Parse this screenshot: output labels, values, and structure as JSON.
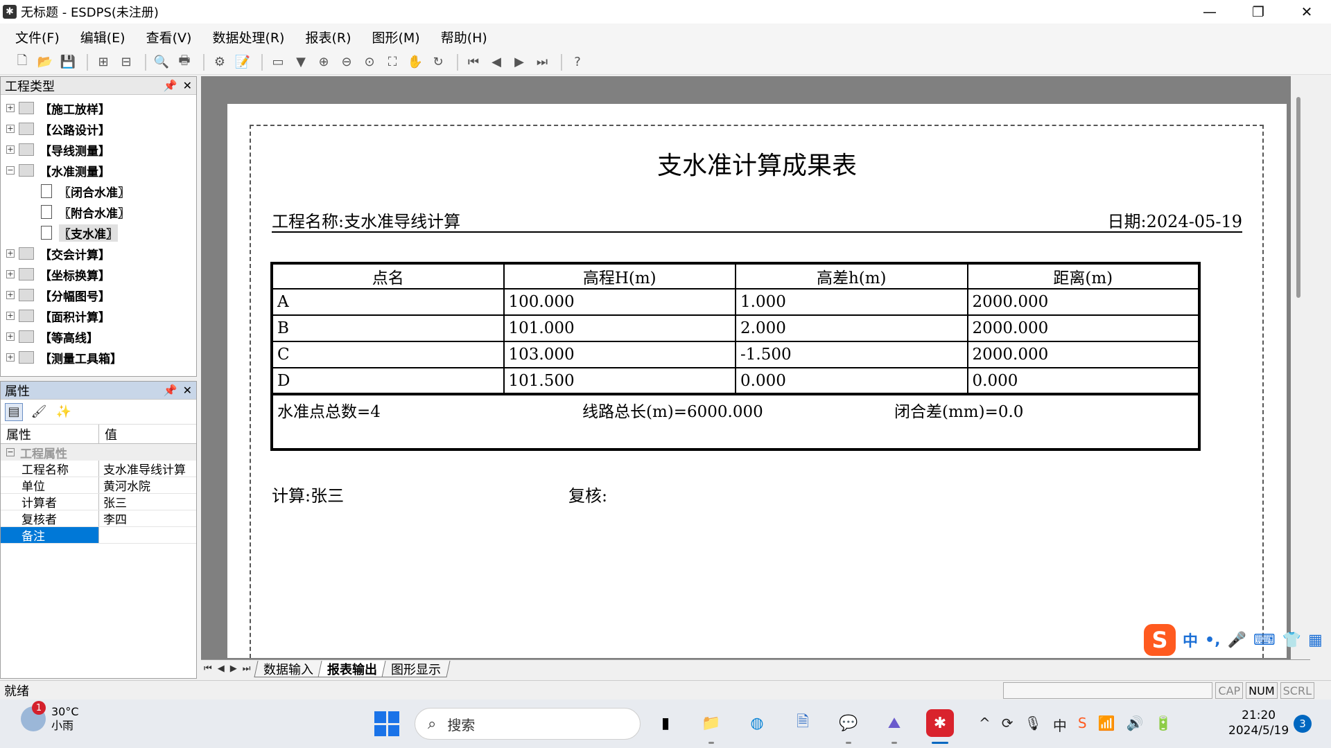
{
  "window": {
    "title": "无标题 - ESDPS(未注册)",
    "app_icon": "star-icon",
    "controls": [
      "minimize-icon",
      "restore-icon",
      "close-icon"
    ]
  },
  "menu": [
    {
      "label": "文件(F)"
    },
    {
      "label": "编辑(E)"
    },
    {
      "label": "查看(V)"
    },
    {
      "label": "数据处理(R)"
    },
    {
      "label": "报表(R)"
    },
    {
      "label": "图形(M)"
    },
    {
      "label": "帮助(H)"
    }
  ],
  "project_panel": {
    "title": "工程类型",
    "tree": [
      {
        "label": "【施工放样】",
        "expanded": false
      },
      {
        "label": "【公路设计】",
        "expanded": false
      },
      {
        "label": "【导线测量】",
        "expanded": false
      },
      {
        "label": "【水准测量】",
        "expanded": true
      },
      {
        "label": "〖闭合水准〗",
        "child": true
      },
      {
        "label": "〖附合水准〗",
        "child": true
      },
      {
        "label": "〖支水准〗",
        "child": true,
        "selected": true
      },
      {
        "label": "【交会计算】",
        "expanded": false
      },
      {
        "label": "【坐标换算】",
        "expanded": false
      },
      {
        "label": "【分幅图号】",
        "expanded": false
      },
      {
        "label": "【面积计算】",
        "expanded": false
      },
      {
        "label": "【等高线】",
        "expanded": false
      },
      {
        "label": "【测量工具箱】",
        "expanded": false
      }
    ]
  },
  "properties_panel": {
    "title": "属性",
    "col_name": "属性",
    "col_value": "值",
    "category": "工程属性",
    "rows": [
      {
        "key": "工程名称",
        "value": "支水准导线计算"
      },
      {
        "key": "单位",
        "value": "黄河水院"
      },
      {
        "key": "计算者",
        "value": "张三"
      },
      {
        "key": "复核者",
        "value": "李四"
      },
      {
        "key": "备注",
        "value": "",
        "selected": true
      }
    ]
  },
  "report": {
    "title": "支水准计算成果表",
    "project_label": "工程名称:支水准导线计算",
    "date_label": "日期:2024-05-19",
    "headers": [
      "点名",
      "高程H(m)",
      "高差h(m)",
      "距离(m)"
    ],
    "rows": [
      [
        "A",
        "100.000",
        "1.000",
        "2000.000"
      ],
      [
        "B",
        "101.000",
        "2.000",
        "2000.000"
      ],
      [
        "C",
        "103.000",
        "-1.500",
        "2000.000"
      ],
      [
        "D",
        "101.500",
        "0.000",
        "0.000"
      ]
    ],
    "summary": {
      "count": "水准点总数=4",
      "length": "线路总长(m)=6000.000",
      "closure": "闭合差(mm)=0.0"
    },
    "calc_label": "计算:张三",
    "check_label": "复核:"
  },
  "tabs": [
    {
      "label": "数据输入"
    },
    {
      "label": "报表输出",
      "active": true
    },
    {
      "label": "图形显示"
    }
  ],
  "status": {
    "text": "就绪",
    "indicators": [
      "CAP",
      "NUM",
      "SCRL"
    ]
  },
  "ime": {
    "mode": "中"
  },
  "taskbar": {
    "weather_temp": "30°C",
    "weather_desc": "小雨",
    "weather_badge": "1",
    "search_placeholder": "搜索",
    "ime_tray": "中",
    "time": "21:20",
    "date": "2024/5/19",
    "notification_count": "3"
  }
}
